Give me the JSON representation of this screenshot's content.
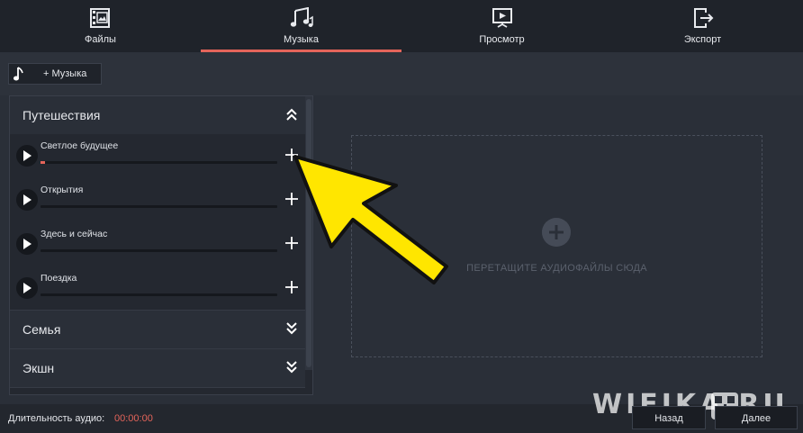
{
  "nav": {
    "tabs": [
      {
        "label": "Файлы",
        "icon": "files-icon",
        "active": false
      },
      {
        "label": "Музыка",
        "icon": "music-icon",
        "active": true
      },
      {
        "label": "Просмотр",
        "icon": "preview-icon",
        "active": false
      },
      {
        "label": "Экспорт",
        "icon": "export-icon",
        "active": false
      }
    ]
  },
  "toolbar": {
    "add_music_label": "+ Музыка"
  },
  "categories": {
    "travel": {
      "title": "Путешествия",
      "expanded": true
    },
    "family": {
      "title": "Семья",
      "expanded": false
    },
    "action": {
      "title": "Экшн",
      "expanded": false
    }
  },
  "tracks": [
    {
      "name": "Светлое будущее",
      "progress": 0.02
    },
    {
      "name": "Открытия",
      "progress": 0
    },
    {
      "name": "Здесь и сейчас",
      "progress": 0
    },
    {
      "name": "Поездка",
      "progress": 0
    }
  ],
  "dropzone": {
    "text": "ПЕРЕТАЩИТЕ АУДИОФАЙЛЫ СЮДА"
  },
  "footer": {
    "duration_label": "Длительность аудио:",
    "duration_value": "00:00:00",
    "back_label": "Назад",
    "next_label": "Далее"
  },
  "watermark": {
    "text": "WIFIKA.RU"
  },
  "colors": {
    "accent": "#e4645a",
    "annotation": "#ffe600"
  }
}
